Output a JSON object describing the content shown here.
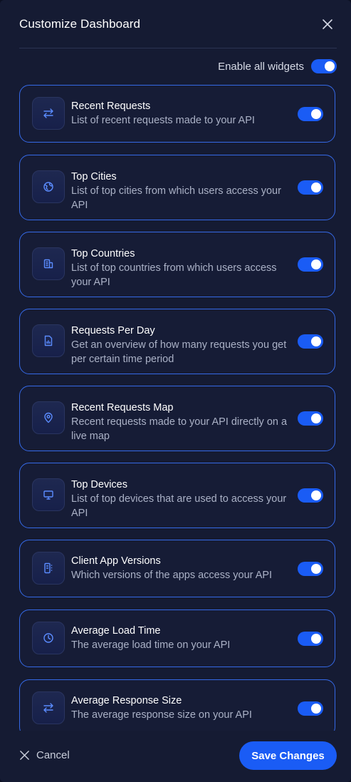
{
  "dialog": {
    "title": "Customize Dashboard",
    "close_icon": "close-icon"
  },
  "enable_all": {
    "label": "Enable all widgets",
    "enabled": true
  },
  "widgets": [
    {
      "name": "Recent Requests",
      "description": "List of recent requests made to your API",
      "icon": "arrows-swap-icon",
      "enabled": true
    },
    {
      "name": "Top Cities",
      "description": "List of top cities from which users access your API",
      "icon": "globe-icon",
      "enabled": true
    },
    {
      "name": "Top Countries",
      "description": "List of top countries from which users access your API",
      "icon": "buildings-icon",
      "enabled": true
    },
    {
      "name": "Requests Per Day",
      "description": "Get an overview of how many requests you get per certain time period",
      "icon": "chart-file-icon",
      "enabled": true
    },
    {
      "name": "Recent Requests Map",
      "description": "Recent requests made to your API directly on a live map",
      "icon": "map-pin-icon",
      "enabled": true
    },
    {
      "name": "Top Devices",
      "description": "List of top devices that are used to access your API",
      "icon": "monitor-icon",
      "enabled": true
    },
    {
      "name": "Client App Versions",
      "description": "Which versions of the apps access your API",
      "icon": "app-grid-icon",
      "enabled": true
    },
    {
      "name": "Average Load Time",
      "description": "The average load time on your API",
      "icon": "clock-icon",
      "enabled": true
    },
    {
      "name": "Average Response Size",
      "description": "The average response size on your API",
      "icon": "arrows-swap-icon",
      "enabled": true
    }
  ],
  "footer": {
    "cancel_label": "Cancel",
    "save_label": "Save Changes"
  },
  "colors": {
    "accent": "#1a5cf5",
    "card_border": "#3569e6",
    "background": "#151b33",
    "icon_stroke": "#5b8cff"
  }
}
